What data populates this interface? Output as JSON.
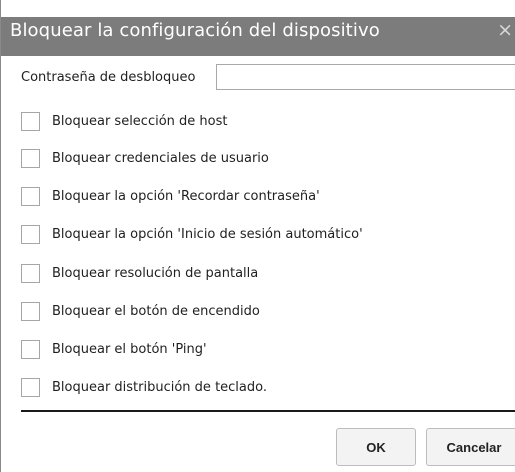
{
  "dialog": {
    "title": "Bloquear la configuración del dispositivo",
    "close_glyph": "×"
  },
  "password": {
    "label": "Contraseña de desbloqueo",
    "value": ""
  },
  "options": [
    {
      "label": "Bloquear selección de host",
      "checked": false
    },
    {
      "label": "Bloquear credenciales de usuario",
      "checked": false
    },
    {
      "label": "Bloquear la opción 'Recordar contraseña'",
      "checked": false
    },
    {
      "label": "Bloquear la opción 'Inicio de sesión automático'",
      "checked": false
    },
    {
      "label": "Bloquear resolución de pantalla",
      "checked": false
    },
    {
      "label": "Bloquear el botón de encendido",
      "checked": false
    },
    {
      "label": "Bloquear el botón 'Ping'",
      "checked": false
    },
    {
      "label": "Bloquear distribución de teclado.",
      "checked": false
    }
  ],
  "buttons": {
    "ok_label": "OK",
    "cancel_label": "Cancelar"
  },
  "colors": {
    "titlebar": "#7c7c7c",
    "title_text": "#ffffff"
  }
}
